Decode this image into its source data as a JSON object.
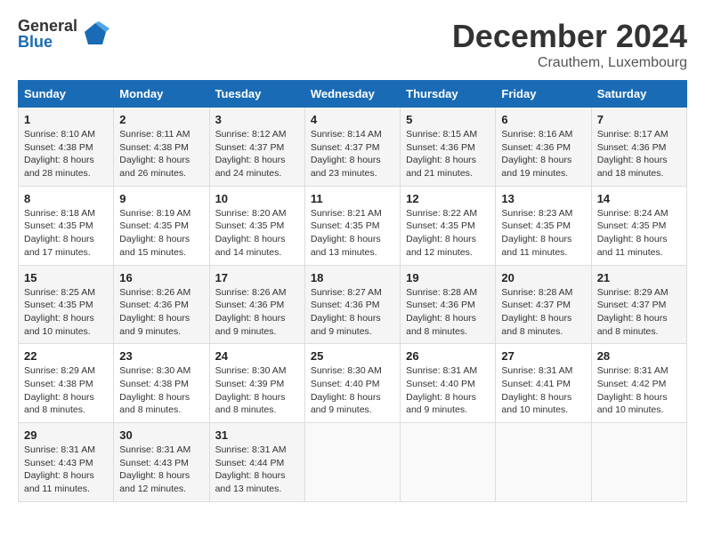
{
  "logo": {
    "general": "General",
    "blue": "Blue"
  },
  "title": "December 2024",
  "location": "Crauthem, Luxembourg",
  "days_of_week": [
    "Sunday",
    "Monday",
    "Tuesday",
    "Wednesday",
    "Thursday",
    "Friday",
    "Saturday"
  ],
  "weeks": [
    [
      {
        "day": "1",
        "sunrise": "8:10 AM",
        "sunset": "4:38 PM",
        "daylight": "8 hours and 28 minutes."
      },
      {
        "day": "2",
        "sunrise": "8:11 AM",
        "sunset": "4:38 PM",
        "daylight": "8 hours and 26 minutes."
      },
      {
        "day": "3",
        "sunrise": "8:12 AM",
        "sunset": "4:37 PM",
        "daylight": "8 hours and 24 minutes."
      },
      {
        "day": "4",
        "sunrise": "8:14 AM",
        "sunset": "4:37 PM",
        "daylight": "8 hours and 23 minutes."
      },
      {
        "day": "5",
        "sunrise": "8:15 AM",
        "sunset": "4:36 PM",
        "daylight": "8 hours and 21 minutes."
      },
      {
        "day": "6",
        "sunrise": "8:16 AM",
        "sunset": "4:36 PM",
        "daylight": "8 hours and 19 minutes."
      },
      {
        "day": "7",
        "sunrise": "8:17 AM",
        "sunset": "4:36 PM",
        "daylight": "8 hours and 18 minutes."
      }
    ],
    [
      {
        "day": "8",
        "sunrise": "8:18 AM",
        "sunset": "4:35 PM",
        "daylight": "8 hours and 17 minutes."
      },
      {
        "day": "9",
        "sunrise": "8:19 AM",
        "sunset": "4:35 PM",
        "daylight": "8 hours and 15 minutes."
      },
      {
        "day": "10",
        "sunrise": "8:20 AM",
        "sunset": "4:35 PM",
        "daylight": "8 hours and 14 minutes."
      },
      {
        "day": "11",
        "sunrise": "8:21 AM",
        "sunset": "4:35 PM",
        "daylight": "8 hours and 13 minutes."
      },
      {
        "day": "12",
        "sunrise": "8:22 AM",
        "sunset": "4:35 PM",
        "daylight": "8 hours and 12 minutes."
      },
      {
        "day": "13",
        "sunrise": "8:23 AM",
        "sunset": "4:35 PM",
        "daylight": "8 hours and 11 minutes."
      },
      {
        "day": "14",
        "sunrise": "8:24 AM",
        "sunset": "4:35 PM",
        "daylight": "8 hours and 11 minutes."
      }
    ],
    [
      {
        "day": "15",
        "sunrise": "8:25 AM",
        "sunset": "4:35 PM",
        "daylight": "8 hours and 10 minutes."
      },
      {
        "day": "16",
        "sunrise": "8:26 AM",
        "sunset": "4:36 PM",
        "daylight": "8 hours and 9 minutes."
      },
      {
        "day": "17",
        "sunrise": "8:26 AM",
        "sunset": "4:36 PM",
        "daylight": "8 hours and 9 minutes."
      },
      {
        "day": "18",
        "sunrise": "8:27 AM",
        "sunset": "4:36 PM",
        "daylight": "8 hours and 9 minutes."
      },
      {
        "day": "19",
        "sunrise": "8:28 AM",
        "sunset": "4:36 PM",
        "daylight": "8 hours and 8 minutes."
      },
      {
        "day": "20",
        "sunrise": "8:28 AM",
        "sunset": "4:37 PM",
        "daylight": "8 hours and 8 minutes."
      },
      {
        "day": "21",
        "sunrise": "8:29 AM",
        "sunset": "4:37 PM",
        "daylight": "8 hours and 8 minutes."
      }
    ],
    [
      {
        "day": "22",
        "sunrise": "8:29 AM",
        "sunset": "4:38 PM",
        "daylight": "8 hours and 8 minutes."
      },
      {
        "day": "23",
        "sunrise": "8:30 AM",
        "sunset": "4:38 PM",
        "daylight": "8 hours and 8 minutes."
      },
      {
        "day": "24",
        "sunrise": "8:30 AM",
        "sunset": "4:39 PM",
        "daylight": "8 hours and 8 minutes."
      },
      {
        "day": "25",
        "sunrise": "8:30 AM",
        "sunset": "4:40 PM",
        "daylight": "8 hours and 9 minutes."
      },
      {
        "day": "26",
        "sunrise": "8:31 AM",
        "sunset": "4:40 PM",
        "daylight": "8 hours and 9 minutes."
      },
      {
        "day": "27",
        "sunrise": "8:31 AM",
        "sunset": "4:41 PM",
        "daylight": "8 hours and 10 minutes."
      },
      {
        "day": "28",
        "sunrise": "8:31 AM",
        "sunset": "4:42 PM",
        "daylight": "8 hours and 10 minutes."
      }
    ],
    [
      {
        "day": "29",
        "sunrise": "8:31 AM",
        "sunset": "4:43 PM",
        "daylight": "8 hours and 11 minutes."
      },
      {
        "day": "30",
        "sunrise": "8:31 AM",
        "sunset": "4:43 PM",
        "daylight": "8 hours and 12 minutes."
      },
      {
        "day": "31",
        "sunrise": "8:31 AM",
        "sunset": "4:44 PM",
        "daylight": "8 hours and 13 minutes."
      },
      null,
      null,
      null,
      null
    ]
  ]
}
